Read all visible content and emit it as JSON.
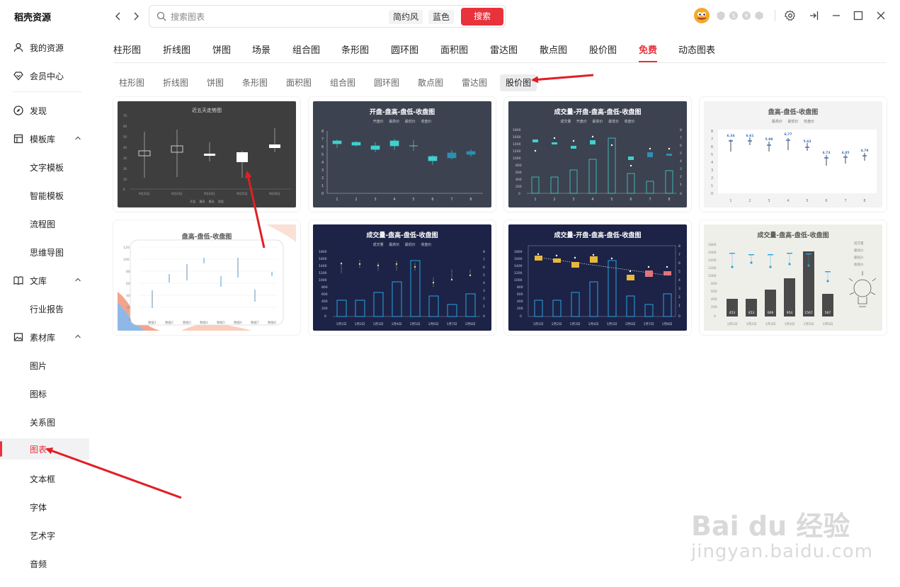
{
  "app": {
    "title": "稻壳资源"
  },
  "sidebar": {
    "items": [
      {
        "label": "我的资源"
      },
      {
        "label": "会员中心"
      },
      {
        "label": "发现"
      },
      {
        "label": "模板库"
      },
      {
        "label": "文字模板"
      },
      {
        "label": "智能模板"
      },
      {
        "label": "流程图"
      },
      {
        "label": "思维导图"
      },
      {
        "label": "文库"
      },
      {
        "label": "行业报告"
      },
      {
        "label": "素材库"
      },
      {
        "label": "图片"
      },
      {
        "label": "图标"
      },
      {
        "label": "关系图"
      },
      {
        "label": "图表"
      },
      {
        "label": "文本框"
      },
      {
        "label": "字体"
      },
      {
        "label": "艺术字"
      },
      {
        "label": "音频"
      }
    ]
  },
  "search": {
    "placeholder": "搜索图表",
    "tag1": "简约风",
    "tag2": "蓝色",
    "button": "搜索"
  },
  "tabs": [
    "柱形图",
    "折线图",
    "饼图",
    "场景",
    "组合图",
    "条形图",
    "圆环图",
    "面积图",
    "雷达图",
    "散点图",
    "股价图",
    "免费",
    "动态图表"
  ],
  "active_tab": "免费",
  "subtabs": [
    "柱形图",
    "折线图",
    "饼图",
    "条形图",
    "面积图",
    "组合图",
    "圆环图",
    "散点图",
    "雷达图",
    "股价图"
  ],
  "active_subtab": "股价图",
  "cards": [
    {
      "title": "近五天走势图",
      "legend": "开盘 最高 最低 收盘",
      "x": [
        "9月22日",
        "9月23日",
        "9月24日",
        "9月25日",
        "9月26日"
      ],
      "y": [
        "70",
        "60",
        "50",
        "40",
        "30",
        "20",
        "10",
        "0"
      ]
    },
    {
      "title": "开盘-盘高-盘低-收盘图",
      "legend": "开盘价 最高价 最低价 收盘价",
      "x": [
        "1",
        "2",
        "3",
        "4",
        "5",
        "6",
        "7",
        "8"
      ],
      "y": [
        "8",
        "7",
        "6",
        "5",
        "4",
        "3",
        "2",
        "1",
        "0"
      ]
    },
    {
      "title": "成交量-开盘-盘高-盘低-收盘图",
      "legend": "成交量 开盘价 最高价 最低价 收盘价",
      "x": [
        "1",
        "2",
        "3",
        "4",
        "5",
        "6",
        "7",
        "8"
      ],
      "y": [
        "1800",
        "1600",
        "1400",
        "1200",
        "1000",
        "800",
        "600",
        "400",
        "200",
        "0"
      ],
      "y2": [
        "8",
        "7",
        "6",
        "5",
        "4",
        "3",
        "2",
        "1",
        "0"
      ]
    },
    {
      "title": "盘高-盘低-收盘图",
      "legend": "最高价 最低价 收盘价",
      "x": [
        "1",
        "2",
        "3",
        "4",
        "5",
        "6",
        "7",
        "8"
      ],
      "y": [
        "8",
        "7",
        "6",
        "5",
        "4",
        "3",
        "2",
        "1",
        "0"
      ],
      "labels": [
        "6.34",
        "6.61",
        "5.98",
        "6.77",
        "5.63",
        "4.73",
        "4.85",
        "4.79"
      ]
    },
    {
      "title": "盘高-盘低-收盘图",
      "x": [
        "数据1",
        "数据2",
        "数据3",
        "数据4",
        "数据5",
        "数据6",
        "数据7",
        "数据8"
      ],
      "y": [
        "120",
        "100",
        "80",
        "60",
        "40",
        "20",
        "0"
      ]
    },
    {
      "title": "成交量-盘高-盘低-收盘图",
      "legend": "成交量 最高价 最低价 收盘价",
      "x": [
        "1月1日",
        "1月2日",
        "1月3日",
        "1月4日",
        "1月5日",
        "1月6日",
        "1月7日",
        "1月8日"
      ],
      "y": [
        "1800",
        "1600",
        "1400",
        "1200",
        "1000",
        "800",
        "600",
        "400",
        "200",
        "0"
      ],
      "y2": [
        "8",
        "7",
        "6",
        "5",
        "4",
        "3",
        "2",
        "1",
        "0"
      ]
    },
    {
      "title": "成交量-开盘-盘高-盘低-收盘图",
      "x": [
        "1月1日",
        "1月2日",
        "1月3日",
        "1月4日",
        "1月5日",
        "1月6日",
        "1月7日",
        "1月8日"
      ],
      "y": [
        "1800",
        "1600",
        "1400",
        "1200",
        "1000",
        "800",
        "600",
        "400",
        "200",
        "0"
      ],
      "y2": [
        "8",
        "7",
        "6",
        "5",
        "4",
        "3",
        "2",
        "1",
        "0"
      ]
    },
    {
      "title": "成交量-盘高-盘低-收盘图",
      "x": [
        "1月1日",
        "1月2日",
        "1月3日",
        "1月4日",
        "1月5日",
        "1月6日"
      ],
      "y": [
        "1800",
        "1600",
        "1400",
        "1200",
        "1000",
        "800",
        "600",
        "400",
        "200",
        "0"
      ],
      "bars": [
        "453",
        "453",
        "669",
        "954",
        "1567",
        "567"
      ],
      "legend_items": [
        "成交量",
        "最高价",
        "最低价",
        "收盘价"
      ]
    }
  ],
  "watermark": {
    "logo": "Bai du 经验",
    "url": "jingyan.baidu.com"
  },
  "colors": {
    "accent": "#e8323c",
    "card_dark": "#3e3e3e",
    "card_slate": "#3c4250",
    "card_navy": "#1c2347",
    "teal": "#3fd1cf",
    "annotation_arrow": "#e11f26"
  }
}
